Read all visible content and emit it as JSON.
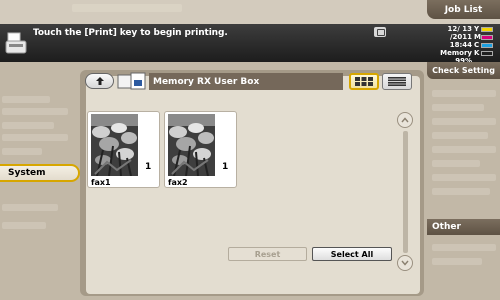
{
  "header": {
    "job_list_label": "Job List",
    "message": "Touch the [Print] key to begin printing.",
    "date": "12/ 13 /2011",
    "time": "18:44",
    "memory_label": "Memory",
    "memory_value": "99%",
    "toner": [
      {
        "letter": "Y",
        "color": "#f2d400"
      },
      {
        "letter": "M",
        "color": "#d4007a"
      },
      {
        "letter": "C",
        "color": "#1c9fe0"
      },
      {
        "letter": "K",
        "color": "#202020"
      }
    ]
  },
  "sidebar": {
    "check_setting_label": "Check Setting",
    "selected_tab_label": "System",
    "other_label": "Other"
  },
  "box": {
    "title": "Memory RX User Box",
    "documents": [
      {
        "name": "fax1",
        "count": "1"
      },
      {
        "name": "fax2",
        "count": "1"
      }
    ]
  },
  "actions": {
    "reset_label": "Reset",
    "select_all_label": "Select All"
  },
  "colors": {
    "accent_gold": "#d7a600",
    "panel": "#a59a88",
    "title_bar": "#75685a"
  }
}
